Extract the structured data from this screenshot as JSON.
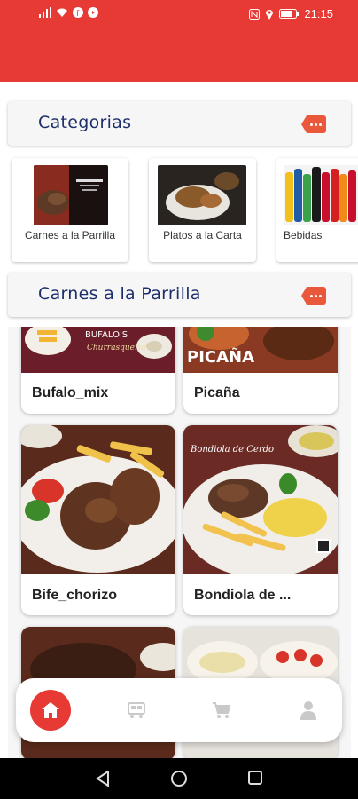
{
  "status_bar": {
    "time": "21:15"
  },
  "categories_section": {
    "title": "Categorias"
  },
  "categories": [
    {
      "label": "Carnes a la Parrilla"
    },
    {
      "label": "Platos a la Carta"
    },
    {
      "label": "Bebidas"
    }
  ],
  "products_section": {
    "title": "Carnes a la Parrilla"
  },
  "products": [
    {
      "name": "Bufalo_mix"
    },
    {
      "name": "Picaña"
    },
    {
      "name": "Bife_chorizo"
    },
    {
      "name": "Bondiola de ..."
    }
  ],
  "image_texts": {
    "bufalo_sign": "BUFALO'S",
    "bufalo_sign_sub": "Churrasqueria",
    "picana_sign": "PICAÑA",
    "bondiola_sign": "Bondiola de Cerdo"
  },
  "nav": [
    {
      "icon": "home-icon",
      "active": true
    },
    {
      "icon": "delivery-icon",
      "active": false
    },
    {
      "icon": "cart-icon",
      "active": false
    },
    {
      "icon": "user-icon",
      "active": false
    }
  ],
  "colors": {
    "brand_red": "#e83a34",
    "header_title": "#1c2f6b",
    "more_button": "#e9583b"
  }
}
